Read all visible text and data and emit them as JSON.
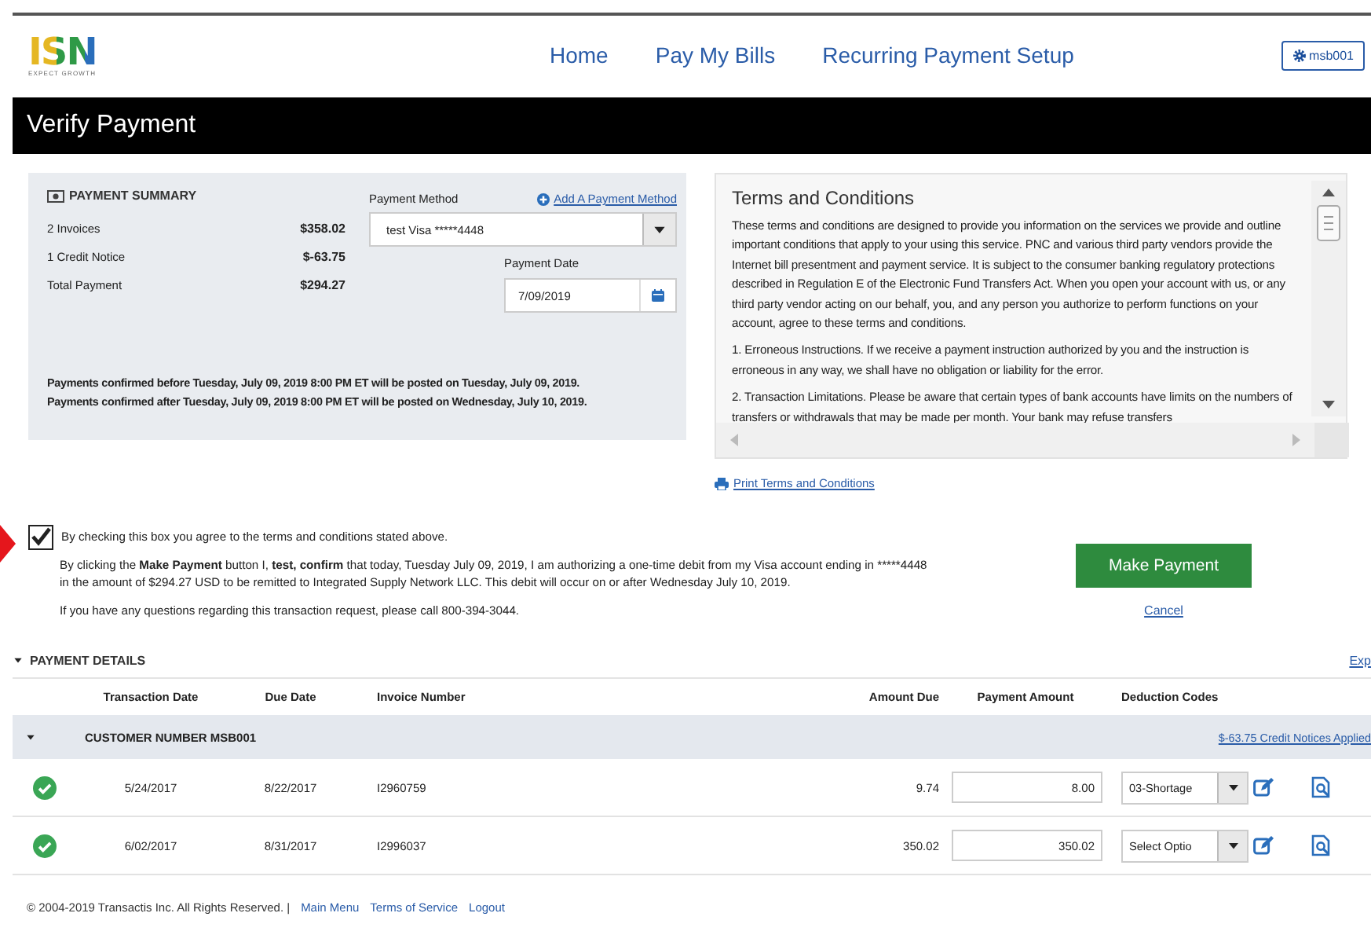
{
  "header": {
    "logo": {
      "mark": "ISN",
      "tagline": "EXPECT GROWTH"
    },
    "nav": [
      {
        "label": "Home"
      },
      {
        "label": "Pay My Bills"
      },
      {
        "label": "Recurring Payment Setup"
      }
    ],
    "user_button": "msb001"
  },
  "page_title": "Verify Payment",
  "summary": {
    "title": "PAYMENT SUMMARY",
    "rows": [
      {
        "label": "2 Invoices",
        "amount": "$358.02"
      },
      {
        "label": "1 Credit Notice",
        "amount": "$-63.75"
      },
      {
        "label": "Total Payment",
        "amount": "$294.27"
      }
    ],
    "payment_method": {
      "label": "Payment Method",
      "value": "test Visa *****4448"
    },
    "add_method_link": "Add A Payment Method",
    "payment_date": {
      "label": "Payment Date",
      "value": "7/09/2019"
    },
    "notes": [
      "Payments confirmed before Tuesday, July 09, 2019 8:00 PM ET will be posted on Tuesday, July 09, 2019.",
      "Payments confirmed after Tuesday, July 09, 2019 8:00 PM ET will be posted on Wednesday, July 10, 2019."
    ]
  },
  "terms": {
    "title": "Terms and Conditions",
    "paragraphs": [
      "These terms and conditions are designed to provide you information on the services we provide and outline important conditions that apply to your using this service. PNC and various third party vendors provide the Internet bill presentment and payment service. It is subject to the consumer banking regulatory protections described in Regulation E of the Electronic Fund Transfers Act. When you open your account with us, or any third party vendor acting on our behalf, you, and any person you authorize to perform functions on your account, agree to these terms and conditions.",
      "1. Erroneous Instructions. If we receive a payment instruction authorized by you and the instruction is erroneous in any way, we shall have no obligation or liability for the error.",
      "2. Transaction Limitations. Please be aware that certain types of bank accounts have limits on the numbers of transfers or withdrawals that may be made per month. Your bank may refuse transfers"
    ],
    "print_link": "Print Terms and Conditions"
  },
  "agreement": {
    "checked": true,
    "label": "By checking this box you agree to the terms and conditions stated above.",
    "authorization": [
      {
        "text": "By clicking the ",
        "bold": false
      },
      {
        "text": "Make Payment",
        "bold": true
      },
      {
        "text": " button I, ",
        "bold": false
      },
      {
        "text": "test, confirm",
        "bold": true
      },
      {
        "text": " that today, Tuesday July 09, 2019, I am authorizing a one-time debit from my Visa account ending in *****4448 in the amount of $294.27 USD to be remitted to Integrated Supply Network LLC. This debit will occur on or after Wednesday July 10, 2019.",
        "bold": false
      }
    ],
    "contact": "If you have any questions regarding this transaction request, please call 800-394-3044."
  },
  "actions": {
    "primary": "Make Payment",
    "cancel": "Cancel"
  },
  "details": {
    "title": "PAYMENT DETAILS",
    "expanded": true,
    "expand_link": "Exp",
    "columns": [
      "Transaction Date",
      "Due Date",
      "Invoice Number",
      "Amount Due",
      "Payment Amount",
      "Deduction Codes"
    ],
    "group": {
      "label": "CUSTOMER NUMBER MSB001",
      "expanded": true,
      "credit_link": "$-63.75 Credit Notices Applied"
    },
    "rows": [
      {
        "verified": true,
        "transaction_date": "5/24/2017",
        "due_date": "8/22/2017",
        "invoice": "I2960759",
        "amount_due": "9.74",
        "payment_amount": "8.00",
        "deduction_code": "03-Shortage"
      },
      {
        "verified": true,
        "transaction_date": "6/02/2017",
        "due_date": "8/31/2017",
        "invoice": "I2996037",
        "amount_due": "350.02",
        "payment_amount": "350.02",
        "deduction_code": "Select Optio"
      }
    ]
  },
  "footer": {
    "copyright": "© 2004-2019 Transactis Inc. All Rights Reserved. |",
    "links": [
      "Main Menu",
      "Terms of Service",
      "Logout"
    ]
  }
}
